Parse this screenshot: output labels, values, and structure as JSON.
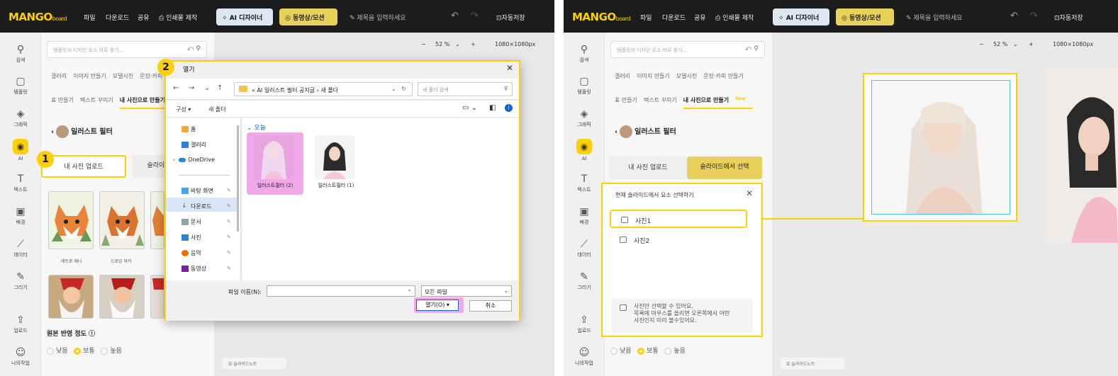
{
  "app": {
    "logo": "MANGO",
    "logo_suffix": "board",
    "menu": [
      "파일",
      "다운로드",
      "공유"
    ],
    "print_menu": "인쇄물 제작",
    "ai_designer": "AI 디자이너",
    "video_motion": "동영상/모션",
    "title_placeholder": "제목을 입력하세요",
    "autosave": "자동저장",
    "zoom": "52 %",
    "canvas_size": "1080×1080px",
    "slide_notes": "슬라이드노트"
  },
  "sidebar": [
    {
      "label": "검색",
      "icon": "search-icon"
    },
    {
      "label": "템플릿",
      "icon": "template-icon"
    },
    {
      "label": "그래픽",
      "icon": "graphic-icon"
    },
    {
      "label": "AI",
      "icon": "ai-icon"
    },
    {
      "label": "텍스트",
      "icon": "text-icon"
    },
    {
      "label": "배경",
      "icon": "background-icon"
    },
    {
      "label": "데이터",
      "icon": "data-icon"
    },
    {
      "label": "그리기",
      "icon": "draw-icon"
    },
    {
      "label": "업로드",
      "icon": "upload-icon"
    },
    {
      "label": "나의작업",
      "icon": "my-work-icon"
    }
  ],
  "panel": {
    "search_placeholder": "템플릿과 디자인 요소 바로 찾기...",
    "tabs_row1": [
      "갤러리",
      "이미지 만들기",
      "모델사진",
      "문장·카피 만들기"
    ],
    "tabs_row2": [
      "표 만들기",
      "텍스트 꾸미기",
      "내 사진으로 만들기"
    ],
    "new_badge": "New",
    "filter_title": "일러스트 필터",
    "upload_btn": "내 사진 업로드",
    "slide_btn": "슬라이드에서 선택",
    "styles": [
      "레트로 애니",
      "드로잉 마카"
    ],
    "strength_label": "원본 반영 정도",
    "strength_options": [
      "낮음",
      "보통",
      "높음"
    ],
    "strength_selected": "보통"
  },
  "steps": {
    "one": "1",
    "two": "2"
  },
  "dialog": {
    "title": "열기",
    "path": "« AI 일러스트 필터 공지글 › 새 폴더",
    "search_placeholder": "새 폴더 검색",
    "organize": "구성 ▾",
    "new_folder": "새 폴더",
    "nav": [
      "홈",
      "갤러리",
      "OneDrive",
      "바탕 화면",
      "다운로드",
      "문서",
      "사진",
      "음악",
      "동영상"
    ],
    "group": "오늘",
    "files": [
      "일러스트필터 (2)",
      "일러스트필터 (1)"
    ],
    "filename_label": "파일 이름(N):",
    "filetype": "모든 파일",
    "open_btn": "열기(O)",
    "cancel_btn": "취소"
  },
  "popup": {
    "title": "현재 슬라이드에서 요소 선택하기",
    "items": [
      "사진1",
      "사진2"
    ],
    "note": [
      "사진만 선택할 수 있어요.",
      "목록에 마우스를 올리면 오른쪽에서 어떤",
      "사진인지 미리 볼수있어요."
    ]
  },
  "colors": {
    "accent": "#ffd000",
    "highlight": "#f0a8ea",
    "topbar": "#1c1c1c",
    "preview_border": "#47c8d6"
  }
}
